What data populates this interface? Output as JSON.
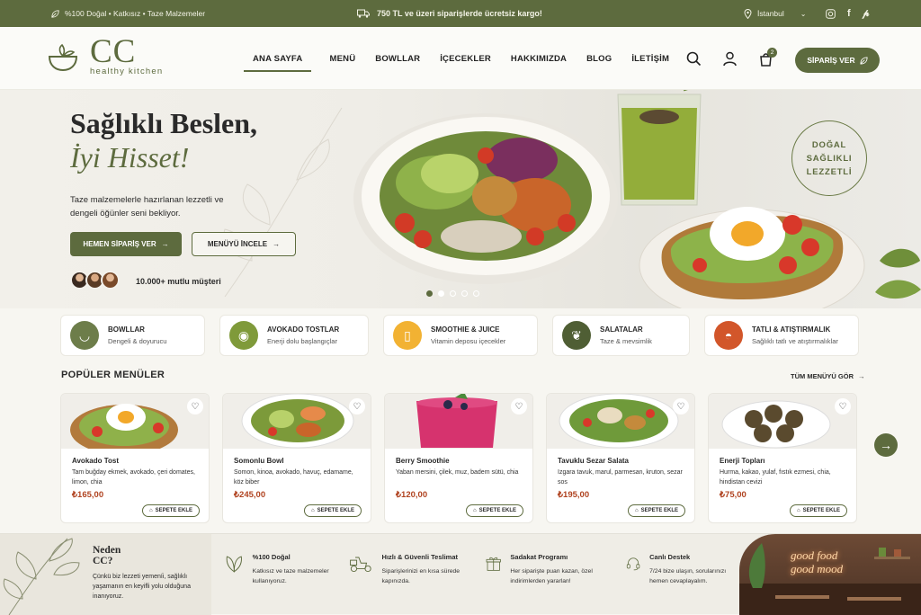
{
  "topbar": {
    "left": "%100 Doğal • Katkısız • Taze Malzemeler",
    "shipping": "750 TL ve üzeri siparişlerde ücretsiz kargo!",
    "city": "İstanbul"
  },
  "brand": {
    "logo": "CC",
    "tagline": "healthy kitchen"
  },
  "nav": {
    "items": [
      "ANA SAYFA",
      "MENÜ",
      "BOWLLAR",
      "İÇECEKLER",
      "HAKKIMIZDA",
      "BLOG",
      "İLETİŞİM"
    ],
    "cart_count": "2",
    "order_button": "SİPARİŞ VER"
  },
  "hero": {
    "title1": "Sağlıklı Beslen,",
    "title2": "İyi Hisset!",
    "desc": "Taze malzemelerle hazırlanan lezzetli ve dengeli öğünler seni bekliyor.",
    "primary": "HEMEN SİPARİŞ VER",
    "secondary": "MENÜYÜ İNCELE",
    "customers": "10.000+ mutlu müşteri",
    "badge": [
      "DOĞAL",
      "SAĞLIKLI",
      "LEZZETLİ"
    ]
  },
  "categories": [
    {
      "title": "BOWLLAR",
      "sub": "Dengeli & doyurucu",
      "color": "#6d7d4a",
      "icon": "bowl-icon"
    },
    {
      "title": "AVOKADO TOSTLAR",
      "sub": "Enerji dolu başlangıçlar",
      "color": "#7f9a3a",
      "icon": "avocado-icon"
    },
    {
      "title": "SMOOTHIE & JUICE",
      "sub": "Vitamin deposu içecekler",
      "color": "#f2b233",
      "icon": "cup-icon"
    },
    {
      "title": "SALATALAR",
      "sub": "Taze & mevsimlik",
      "color": "#4f5e34",
      "icon": "leaf-icon"
    },
    {
      "title": "TATLI & ATIŞTIRMALIK",
      "sub": "Sağlıklı tatlı ve atıştırmalıklar",
      "color": "#d2562a",
      "icon": "dessert-icon"
    }
  ],
  "popular": {
    "title": "POPÜLER MENÜLER",
    "all": "TÜM MENÜYÜ GÖR",
    "add": "SEPETE EKLE"
  },
  "products": [
    {
      "name": "Avokado Tost",
      "desc": "Tam buğday ekmek, avokado, çeri domates, limon, chia",
      "price": "₺165,00"
    },
    {
      "name": "Somonlu Bowl",
      "desc": "Somon, kinoa, avokado, havuç, edamame, köz biber",
      "price": "₺245,00"
    },
    {
      "name": "Berry Smoothie",
      "desc": "Yaban mersini, çilek, muz, badem sütü, chia",
      "price": "₺120,00"
    },
    {
      "name": "Tavuklu Sezar Salata",
      "desc": "Izgara tavuk, marul, parmesan, kruton, sezar sos",
      "price": "₺195,00"
    },
    {
      "name": "Enerji Topları",
      "desc": "Hurma, kakao, yulaf, fıstık ezmesi, chia, hindistan cevizi",
      "price": "₺75,00"
    }
  ],
  "why": {
    "title1": "Neden",
    "title2": "CC?",
    "desc": "Çünkü biz lezzeti yemeníi, sağlıklı yaşamanın en keyifli yolu olduğuna inanıyoruz.",
    "neon1": "good food",
    "neon2": "good mood"
  },
  "features": [
    {
      "title": "%100 Doğal",
      "desc": "Katkısız ve taze malzemeler kullanıyoruz."
    },
    {
      "title": "Hızlı & Güvenli Teslimat",
      "desc": "Siparişlerinizi en kısa sürede kapınızda."
    },
    {
      "title": "Sadakat Programı",
      "desc": "Her siparişte puan kazan, özel indirimlerden yararlan!"
    },
    {
      "title": "Canlı Destek",
      "desc": "7/24 bize ulaşın, sorularınızı hemen cevaplayalım."
    }
  ]
}
